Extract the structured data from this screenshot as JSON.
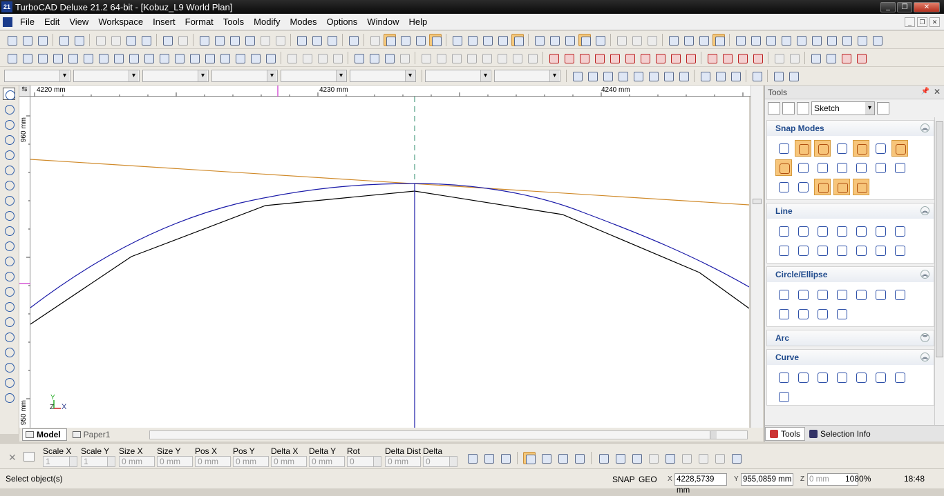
{
  "window": {
    "title": "TurboCAD Deluxe 21.2 64-bit - [Kobuz_L9 World Plan]",
    "app_icon": "21"
  },
  "menus": [
    "File",
    "Edit",
    "View",
    "Workspace",
    "Insert",
    "Format",
    "Tools",
    "Modify",
    "Modes",
    "Options",
    "Window",
    "Help"
  ],
  "ruler": {
    "top_labels": [
      "4220 mm",
      "4230 mm",
      "4240 mm"
    ],
    "left_labels": [
      "960 mm",
      "950 mm"
    ]
  },
  "tabs": {
    "model": "Model",
    "paper": "Paper1"
  },
  "panel": {
    "title": "Tools",
    "mode": "Sketch",
    "sections": [
      {
        "name": "Snap Modes",
        "expanded": true,
        "icons": 21
      },
      {
        "name": "Line",
        "expanded": true,
        "icons": 14
      },
      {
        "name": "Circle/Ellipse",
        "expanded": true,
        "icons": 11
      },
      {
        "name": "Arc",
        "expanded": false,
        "icons": 0
      },
      {
        "name": "Curve",
        "expanded": true,
        "icons": 8
      }
    ],
    "tabs": {
      "tools": "Tools",
      "selection_info": "Selection Info"
    }
  },
  "properties": {
    "scale_x": {
      "label": "Scale X",
      "value": "1"
    },
    "scale_y": {
      "label": "Scale Y",
      "value": "1"
    },
    "size_x": {
      "label": "Size X",
      "value": "0 mm"
    },
    "size_y": {
      "label": "Size Y",
      "value": "0 mm"
    },
    "pos_x": {
      "label": "Pos X",
      "value": "0 mm"
    },
    "pos_y": {
      "label": "Pos Y",
      "value": "0 mm"
    },
    "delta_x": {
      "label": "Delta X",
      "value": "0 mm"
    },
    "delta_y": {
      "label": "Delta Y",
      "value": "0 mm"
    },
    "rot": {
      "label": "Rot",
      "value": "0"
    },
    "delta_dist": {
      "label": "Delta Dist",
      "value": "0 mm"
    },
    "delta_ang": {
      "label": "Delta Ang",
      "value": "0"
    }
  },
  "status": {
    "message": "Select object(s)",
    "snap": "SNAP",
    "geo": "GEO",
    "x_label": "X",
    "x": "4228,5739 mm",
    "y_label": "Y",
    "y": "955,0859 mm",
    "z_label": "Z",
    "z_placeholder": "0 mm",
    "zoom": "1080%",
    "time": "18:48"
  },
  "colors": {
    "curve_blue": "#1a1aa8",
    "ref_line_orange": "#d08a2a",
    "outline_black": "#000000",
    "highlight": "#f7c57a"
  },
  "ucs": {
    "y": "Y",
    "x": "X",
    "z": "Z"
  }
}
